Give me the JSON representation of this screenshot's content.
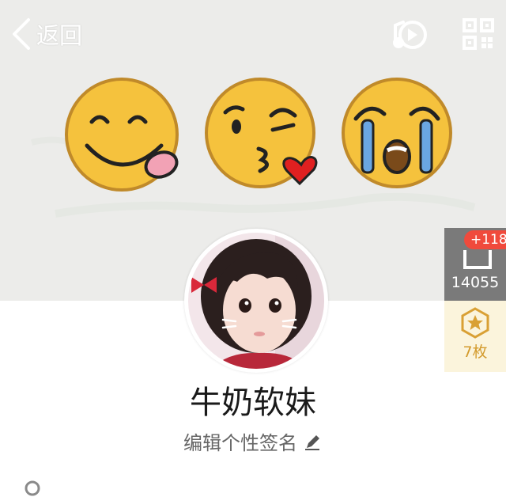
{
  "header": {
    "back_label": "返回",
    "back_icon": "chevron-left-icon",
    "music_icon": "music-disc-icon",
    "qr_icon": "qr-code-icon"
  },
  "cover": {
    "background_color": "#ececea",
    "emojis": [
      "tongue-out-emoji-icon",
      "kiss-wink-emoji-icon",
      "crying-emoji-icon"
    ]
  },
  "side_panel": {
    "visit_badge": "+118",
    "visit_count": "14055",
    "visit_bg": "#7a7a7a",
    "medal_count": "7枚",
    "medal_color": "#d39a2c"
  },
  "profile": {
    "nickname": "牛奶软妹",
    "signature_label": "编辑个性签名",
    "edit_icon": "pencil-icon"
  },
  "colors": {
    "badge_red": "#f04a3c",
    "emoji_yellow": "#f5c23d"
  }
}
